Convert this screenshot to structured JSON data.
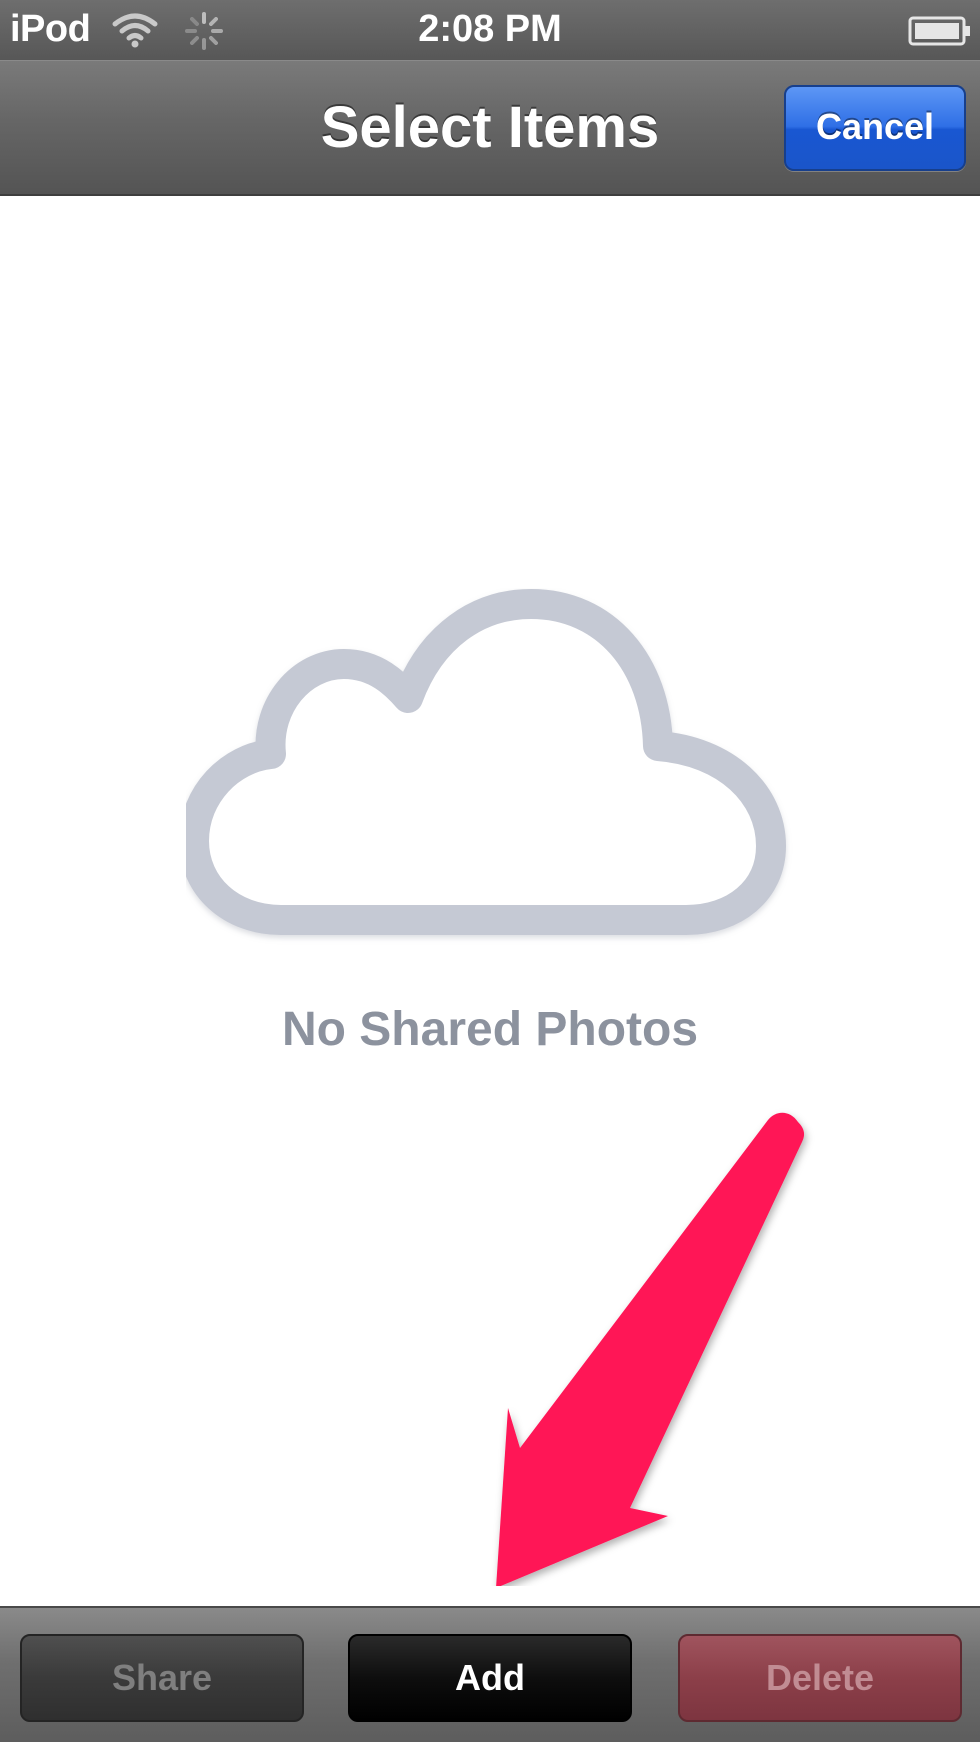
{
  "status_bar": {
    "carrier": "iPod",
    "time": "2:08 PM",
    "icons": [
      "wifi-icon",
      "activity-spinner-icon",
      "battery-icon"
    ]
  },
  "nav_bar": {
    "title": "Select Items",
    "cancel_label": "Cancel"
  },
  "empty_state": {
    "icon": "cloud-icon",
    "message": "No Shared Photos",
    "annotation_icon": "arrow-icon"
  },
  "toolbar": {
    "share_label": "Share",
    "add_label": "Add",
    "delete_label": "Delete"
  },
  "colors": {
    "accent_blue": "#2f6fe6",
    "arrow_pink": "#ff1457",
    "cloud_gray": "#c5c9d4",
    "message_gray": "#8c929e",
    "delete_red": "#8c3f49"
  }
}
